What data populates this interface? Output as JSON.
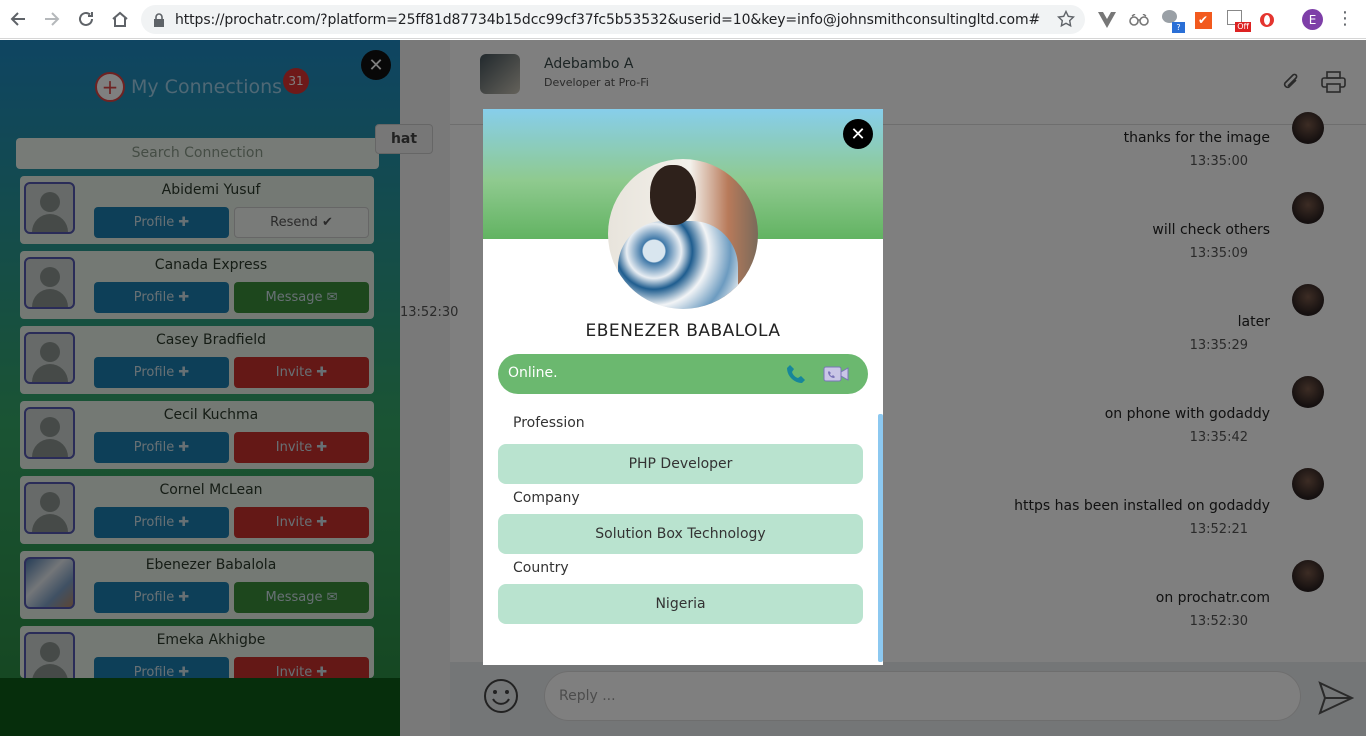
{
  "browser": {
    "url": "https://prochatr.com/?platform=25ff81d87734b15dcc99cf37fc5b53532&userid=10&key=info@johnsmithconsultingltd.com#",
    "profile_initial": "E",
    "ext_badge_off": "Off",
    "ext_badge_q": "?"
  },
  "sidebar": {
    "title": "My Connections",
    "badge": "31",
    "search_placeholder": "Search Connection",
    "connections": [
      {
        "name": "Abidemi Yusuf",
        "btn1": "Profile ✚",
        "btn2": "Resend ✔",
        "type": "resend"
      },
      {
        "name": "Canada Express",
        "btn1": "Profile ✚",
        "btn2": "Message ✉",
        "type": "msg"
      },
      {
        "name": "Casey Bradfield",
        "btn1": "Profile ✚",
        "btn2": "Invite ✚",
        "type": "invite"
      },
      {
        "name": "Cecil Kuchma",
        "btn1": "Profile ✚",
        "btn2": "Invite ✚",
        "type": "invite"
      },
      {
        "name": "Cornel McLean",
        "btn1": "Profile ✚",
        "btn2": "Invite ✚",
        "type": "invite"
      },
      {
        "name": "Ebenezer Babalola",
        "btn1": "Profile ✚",
        "btn2": "Message ✉",
        "type": "msg"
      },
      {
        "name": "Emeka Akhigbe",
        "btn1": "Profile ✚",
        "btn2": "Invite ✚",
        "type": "invite"
      }
    ]
  },
  "chat": {
    "contact_name": "Adebambo A",
    "contact_sub": "Developer at Pro-Fi",
    "tab_label": "hat",
    "side_time": "13:52:30",
    "messages": [
      {
        "text": "thanks for the image",
        "time": "13:35:00"
      },
      {
        "text": "will check others",
        "time": "13:35:09"
      },
      {
        "text": "later",
        "time": "13:35:29"
      },
      {
        "text": "on phone with godaddy",
        "time": "13:35:42"
      },
      {
        "text": "https has been installed on godaddy",
        "time": "13:52:21"
      },
      {
        "text": "on prochatr.com",
        "time": "13:52:30"
      }
    ],
    "reply_placeholder": "Reply ..."
  },
  "modal": {
    "name": "EBENEZER BABALOLA",
    "status": "Online.",
    "profession_label": "Profession",
    "profession": "PHP Developer",
    "company_label": "Company",
    "company": "Solution Box Technology",
    "country_label": "Country",
    "country": "Nigeria"
  },
  "colors": {
    "online": "#6bb86f",
    "field_bg": "#b9e3cf",
    "invite": "#c9302c",
    "message": "#3b8e3b",
    "profile": "#1a7fb0"
  }
}
